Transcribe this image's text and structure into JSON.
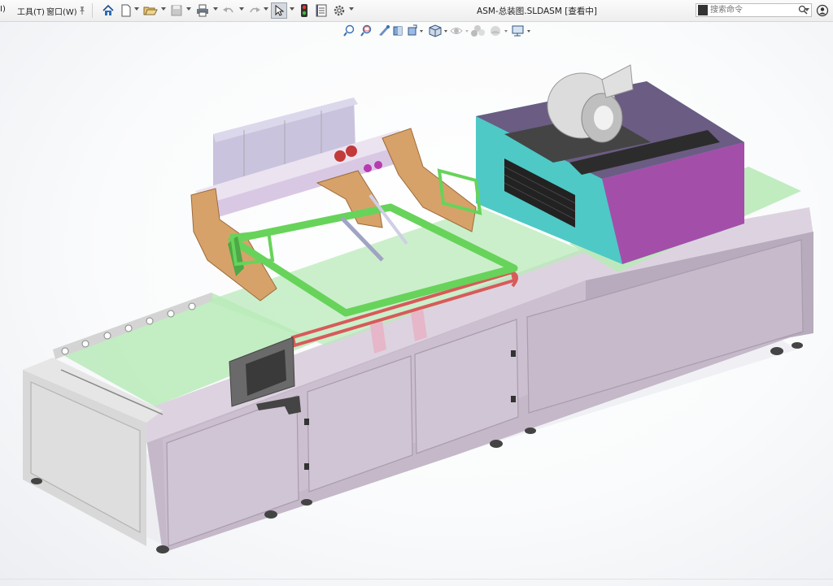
{
  "menu": {
    "partial_item": "I)",
    "tools": "工具(T)",
    "window": "窗口(W)"
  },
  "window_title": "ASM-总装图.SLDASM [查看中]",
  "search": {
    "placeholder": "搜索命令"
  },
  "icons": {
    "pin": "pin-icon",
    "home": "home-icon",
    "new": "new-document-icon",
    "open": "open-folder-icon",
    "save": "save-icon",
    "print": "print-icon",
    "undo": "undo-icon",
    "redo": "redo-icon",
    "select": "select-cursor-icon",
    "traffic": "rebuild-traffic-light-icon",
    "file_props": "file-properties-icon",
    "options": "options-gear-icon",
    "user": "user-icon"
  },
  "colors": {
    "frame": "#c9bccd",
    "frame_shadow": "#a79bae",
    "rail": "#e7e1e9",
    "green_frame": "#67d35a",
    "orange": "#d7a26a",
    "oven_side": "#4ec9c6",
    "oven_top": "#5a4a74",
    "oven_front": "#a34fa9",
    "conveyor": "#b9eab9",
    "red_belt": "#d85a5a",
    "panel": "#6a6a6a"
  }
}
